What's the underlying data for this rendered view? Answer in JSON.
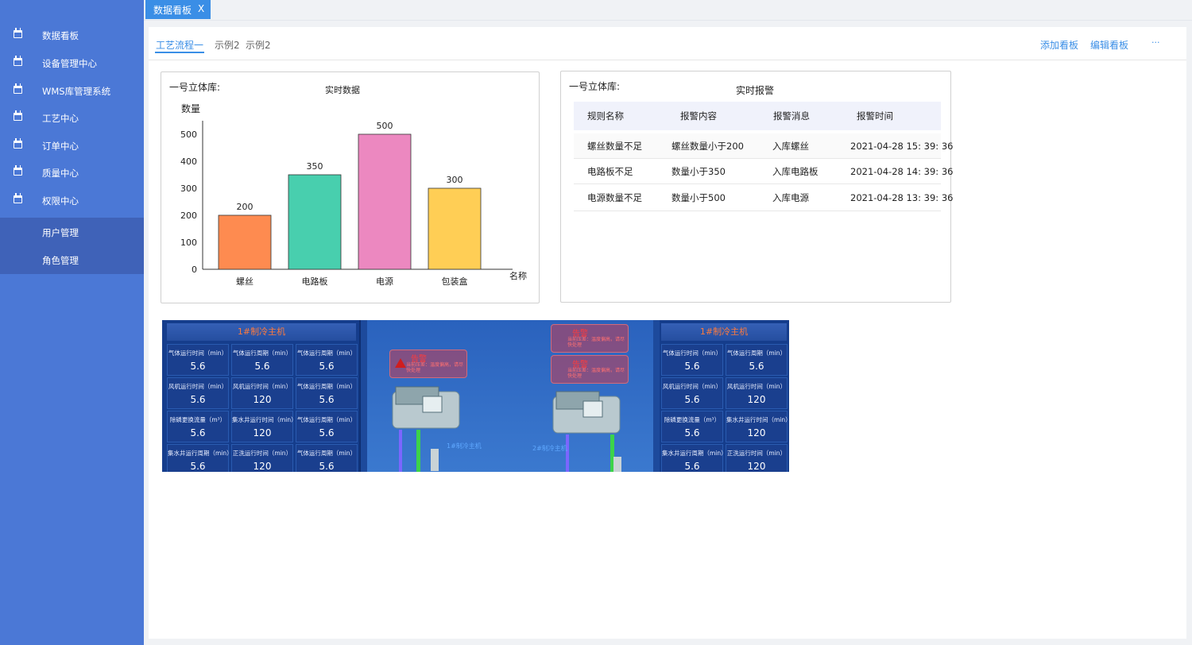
{
  "sidebar": {
    "items": [
      {
        "label": "数据看板"
      },
      {
        "label": "设备管理中心"
      },
      {
        "label": "WMS库管理系统"
      },
      {
        "label": "工艺中心"
      },
      {
        "label": "订单中心"
      },
      {
        "label": "质量中心"
      },
      {
        "label": "权限中心"
      }
    ],
    "submenu": [
      {
        "label": "用户管理"
      },
      {
        "label": "角色管理"
      }
    ]
  },
  "top_tab": {
    "label": "数据看板",
    "close": "X"
  },
  "subtabs": [
    {
      "label": "工艺流程一",
      "active": true
    },
    {
      "label": "示例2"
    },
    {
      "label": "示例2"
    }
  ],
  "actions": {
    "add": "添加看板",
    "edit": "编辑看板",
    "more": "···"
  },
  "chart_card": {
    "title": "一号立体库:"
  },
  "chart_data": {
    "type": "bar",
    "title": "实时数据",
    "ylabel": "数量",
    "xlabel": "名称",
    "categories": [
      "螺丝",
      "电路板",
      "电源",
      "包装盒"
    ],
    "values": [
      200,
      350,
      500,
      300
    ],
    "yticks": [
      0,
      100,
      200,
      300,
      400,
      500
    ],
    "ylim": [
      0,
      550
    ],
    "colors": [
      "#fe8b50",
      "#48cfae",
      "#ec88c0",
      "#ffce55"
    ],
    "grid": false
  },
  "alarm_card": {
    "title": "一号立体库:",
    "heading": "实时报警",
    "columns": [
      "规则名称",
      "报警内容",
      "报警消息",
      "报警时间"
    ],
    "rows": [
      [
        "螺丝数量不足",
        "螺丝数量小于200",
        "入库螺丝",
        "2021-04-28 15: 39: 36"
      ],
      [
        "电路板不足",
        "数量小于350",
        "入库电路板",
        "2021-04-28 14: 39: 36"
      ],
      [
        "电源数量不足",
        "数量小于500",
        "入库电源",
        "2021-04-28 13: 39: 36"
      ]
    ]
  },
  "scada": {
    "left_title": "1#制冷主机",
    "right_title": "1#制冷主机",
    "left_cells": [
      {
        "k": "气体运行时间（min）",
        "v": "5.6"
      },
      {
        "k": "气体运行周期（min）",
        "v": "5.6"
      },
      {
        "k": "气体运行周期（min）",
        "v": "5.6"
      },
      {
        "k": "风机运行时间（min）",
        "v": "5.6"
      },
      {
        "k": "风机运行时间（min）",
        "v": "120"
      },
      {
        "k": "气体运行周期（min）",
        "v": "5.6"
      },
      {
        "k": "除磷更换流量（m³）",
        "v": "5.6"
      },
      {
        "k": "集水井运行时间（min）",
        "v": "120"
      },
      {
        "k": "气体运行周期（min）",
        "v": "5.6"
      },
      {
        "k": "集水井运行周期（min）",
        "v": "5.6"
      },
      {
        "k": "正洗运行时间（min）",
        "v": "120"
      },
      {
        "k": "气体运行周期（min）",
        "v": "5.6"
      }
    ],
    "right_cells": [
      {
        "k": "气体运行时间（min）",
        "v": "5.6"
      },
      {
        "k": "气体运行周期（min）",
        "v": "5.6"
      },
      {
        "k": "风机运行时间（min）",
        "v": "5.6"
      },
      {
        "k": "风机运行时间（min）",
        "v": "120"
      },
      {
        "k": "除磷更换流量（m³）",
        "v": "5.6"
      },
      {
        "k": "集水井运行时间（min）",
        "v": "120"
      },
      {
        "k": "集水井运行周期（min）",
        "v": "5.6"
      },
      {
        "k": "正洗运行时间（min）",
        "v": "120"
      }
    ],
    "alarms": [
      {
        "title": "告警",
        "desc": "当前压差：温度偏高，请尽快处理"
      },
      {
        "title": "告警",
        "desc": "当前压差：温度偏高，请尽快处理"
      },
      {
        "title": "告警",
        "desc": "当前压差：温度偏高，请尽快处理"
      }
    ],
    "chiller1": "1#制冷主机",
    "chiller2": "2#制冷主机"
  }
}
